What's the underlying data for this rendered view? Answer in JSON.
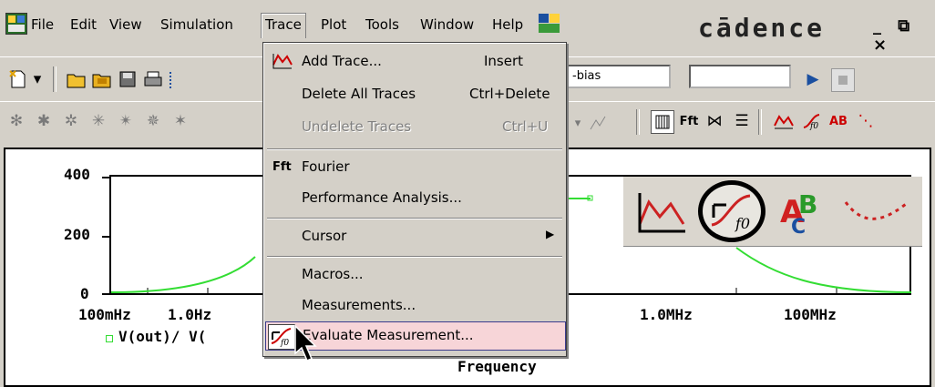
{
  "menubar": {
    "items": [
      "File",
      "Edit",
      "View",
      "Simulation",
      "Trace",
      "Plot",
      "Tools",
      "Window",
      "Help"
    ],
    "brand": "cādence",
    "window_controls": "_ ⧉ ×"
  },
  "toolbar": {
    "profile_combo": "-bias",
    "second_combo": ""
  },
  "trace_menu": {
    "items": [
      {
        "label": "Add Trace...",
        "accel": "Insert",
        "enabled": true,
        "icon": "add-trace-icon"
      },
      {
        "label": "Delete All Traces",
        "accel": "Ctrl+Delete",
        "enabled": true
      },
      {
        "label": "Undelete Traces",
        "accel": "Ctrl+U",
        "enabled": false
      },
      {
        "label": "Fourier",
        "accel": "",
        "enabled": true,
        "icon": "fourier-icon"
      },
      {
        "label": "Performance Analysis...",
        "accel": "",
        "enabled": true
      },
      {
        "label": "Cursor",
        "accel": "",
        "enabled": true,
        "submenu": true
      },
      {
        "label": "Macros...",
        "accel": "",
        "enabled": true
      },
      {
        "label": "Measurements...",
        "accel": "",
        "enabled": true
      },
      {
        "label": "Evaluate Measurement...",
        "accel": "",
        "enabled": true,
        "highlighted": true,
        "icon": "evaluate-measurement-icon"
      }
    ]
  },
  "plot": {
    "y_ticks": [
      "400",
      "200",
      "0"
    ],
    "x_ticks": [
      "100mHz",
      "1.0Hz",
      "1.0MHz",
      "100MHz"
    ],
    "legend": "V(out)/ V(",
    "x_axis_title": "Frequency"
  },
  "colors": {
    "trace": "#33dd33",
    "highlight": "#f7d5d8",
    "callout_circle": "#000000"
  }
}
